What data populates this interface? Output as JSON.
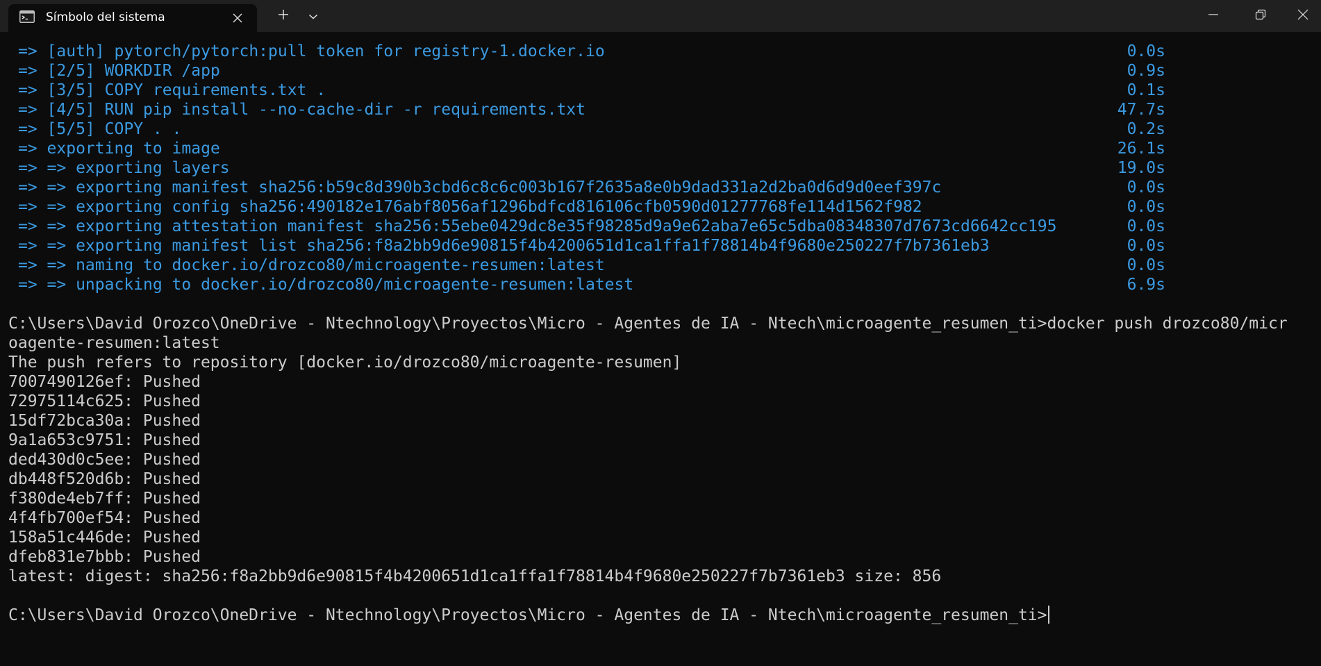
{
  "window": {
    "tab_title": "Símbolo del sistema",
    "icon": "terminal-icon"
  },
  "titlebar_buttons": {
    "tab_close_icon": "close-icon",
    "new_tab_icon": "plus-icon",
    "dropdown_icon": "chevron-down-icon",
    "minimize_icon": "minimize-icon",
    "maximize_icon": "restore-icon",
    "close_icon": "close-icon"
  },
  "colors": {
    "progress_text": "#3b9ae1",
    "plain_text": "#cccccc",
    "background": "#0c0c0c",
    "titlebar": "#202020"
  },
  "build_steps": [
    {
      "text": "=> [auth] pytorch/pytorch:pull token for registry-1.docker.io",
      "time": "0.0s"
    },
    {
      "text": "=> [2/5] WORKDIR /app",
      "time": "0.9s"
    },
    {
      "text": "=> [3/5] COPY requirements.txt .",
      "time": "0.1s"
    },
    {
      "text": "=> [4/5] RUN pip install --no-cache-dir -r requirements.txt",
      "time": "47.7s"
    },
    {
      "text": "=> [5/5] COPY . .",
      "time": "0.2s"
    },
    {
      "text": "=> exporting to image",
      "time": "26.1s"
    },
    {
      "text": "=> => exporting layers",
      "time": "19.0s"
    },
    {
      "text": "=> => exporting manifest sha256:b59c8d390b3cbd6c8c6c003b167f2635a8e0b9dad331a2d2ba0d6d9d0eef397c",
      "time": "0.0s"
    },
    {
      "text": "=> => exporting config sha256:490182e176abf8056af1296bdfcd816106cfb0590d01277768fe114d1562f982",
      "time": "0.0s"
    },
    {
      "text": "=> => exporting attestation manifest sha256:55ebe0429dc8e35f98285d9a9e62aba7e65c5dba08348307d7673cd6642cc195",
      "time": "0.0s"
    },
    {
      "text": "=> => exporting manifest list sha256:f8a2bb9d6e90815f4b4200651d1ca1ffa1f78814b4f9680e250227f7b7361eb3",
      "time": "0.0s"
    },
    {
      "text": "=> => naming to docker.io/drozco80/microagente-resumen:latest",
      "time": "0.0s"
    },
    {
      "text": "=> => unpacking to docker.io/drozco80/microagente-resumen:latest",
      "time": "6.9s"
    }
  ],
  "output_lines": [
    "C:\\Users\\David Orozco\\OneDrive - Ntechnology\\Proyectos\\Micro - Agentes de IA - Ntech\\microagente_resumen_ti>docker push drozco80/micr",
    "oagente-resumen:latest",
    "The push refers to repository [docker.io/drozco80/microagente-resumen]",
    "7007490126ef: Pushed",
    "72975114c625: Pushed",
    "15df72bca30a: Pushed",
    "9a1a653c9751: Pushed",
    "ded430d0c5ee: Pushed",
    "db448f520d6b: Pushed",
    "f380de4eb7ff: Pushed",
    "4f4fb700ef54: Pushed",
    "158a51c446de: Pushed",
    "dfeb831e7bbb: Pushed",
    "latest: digest: sha256:f8a2bb9d6e90815f4b4200651d1ca1ffa1f78814b4f9680e250227f7b7361eb3 size: 856"
  ],
  "prompt": "C:\\Users\\David Orozco\\OneDrive - Ntechnology\\Proyectos\\Micro - Agentes de IA - Ntech\\microagente_resumen_ti>"
}
